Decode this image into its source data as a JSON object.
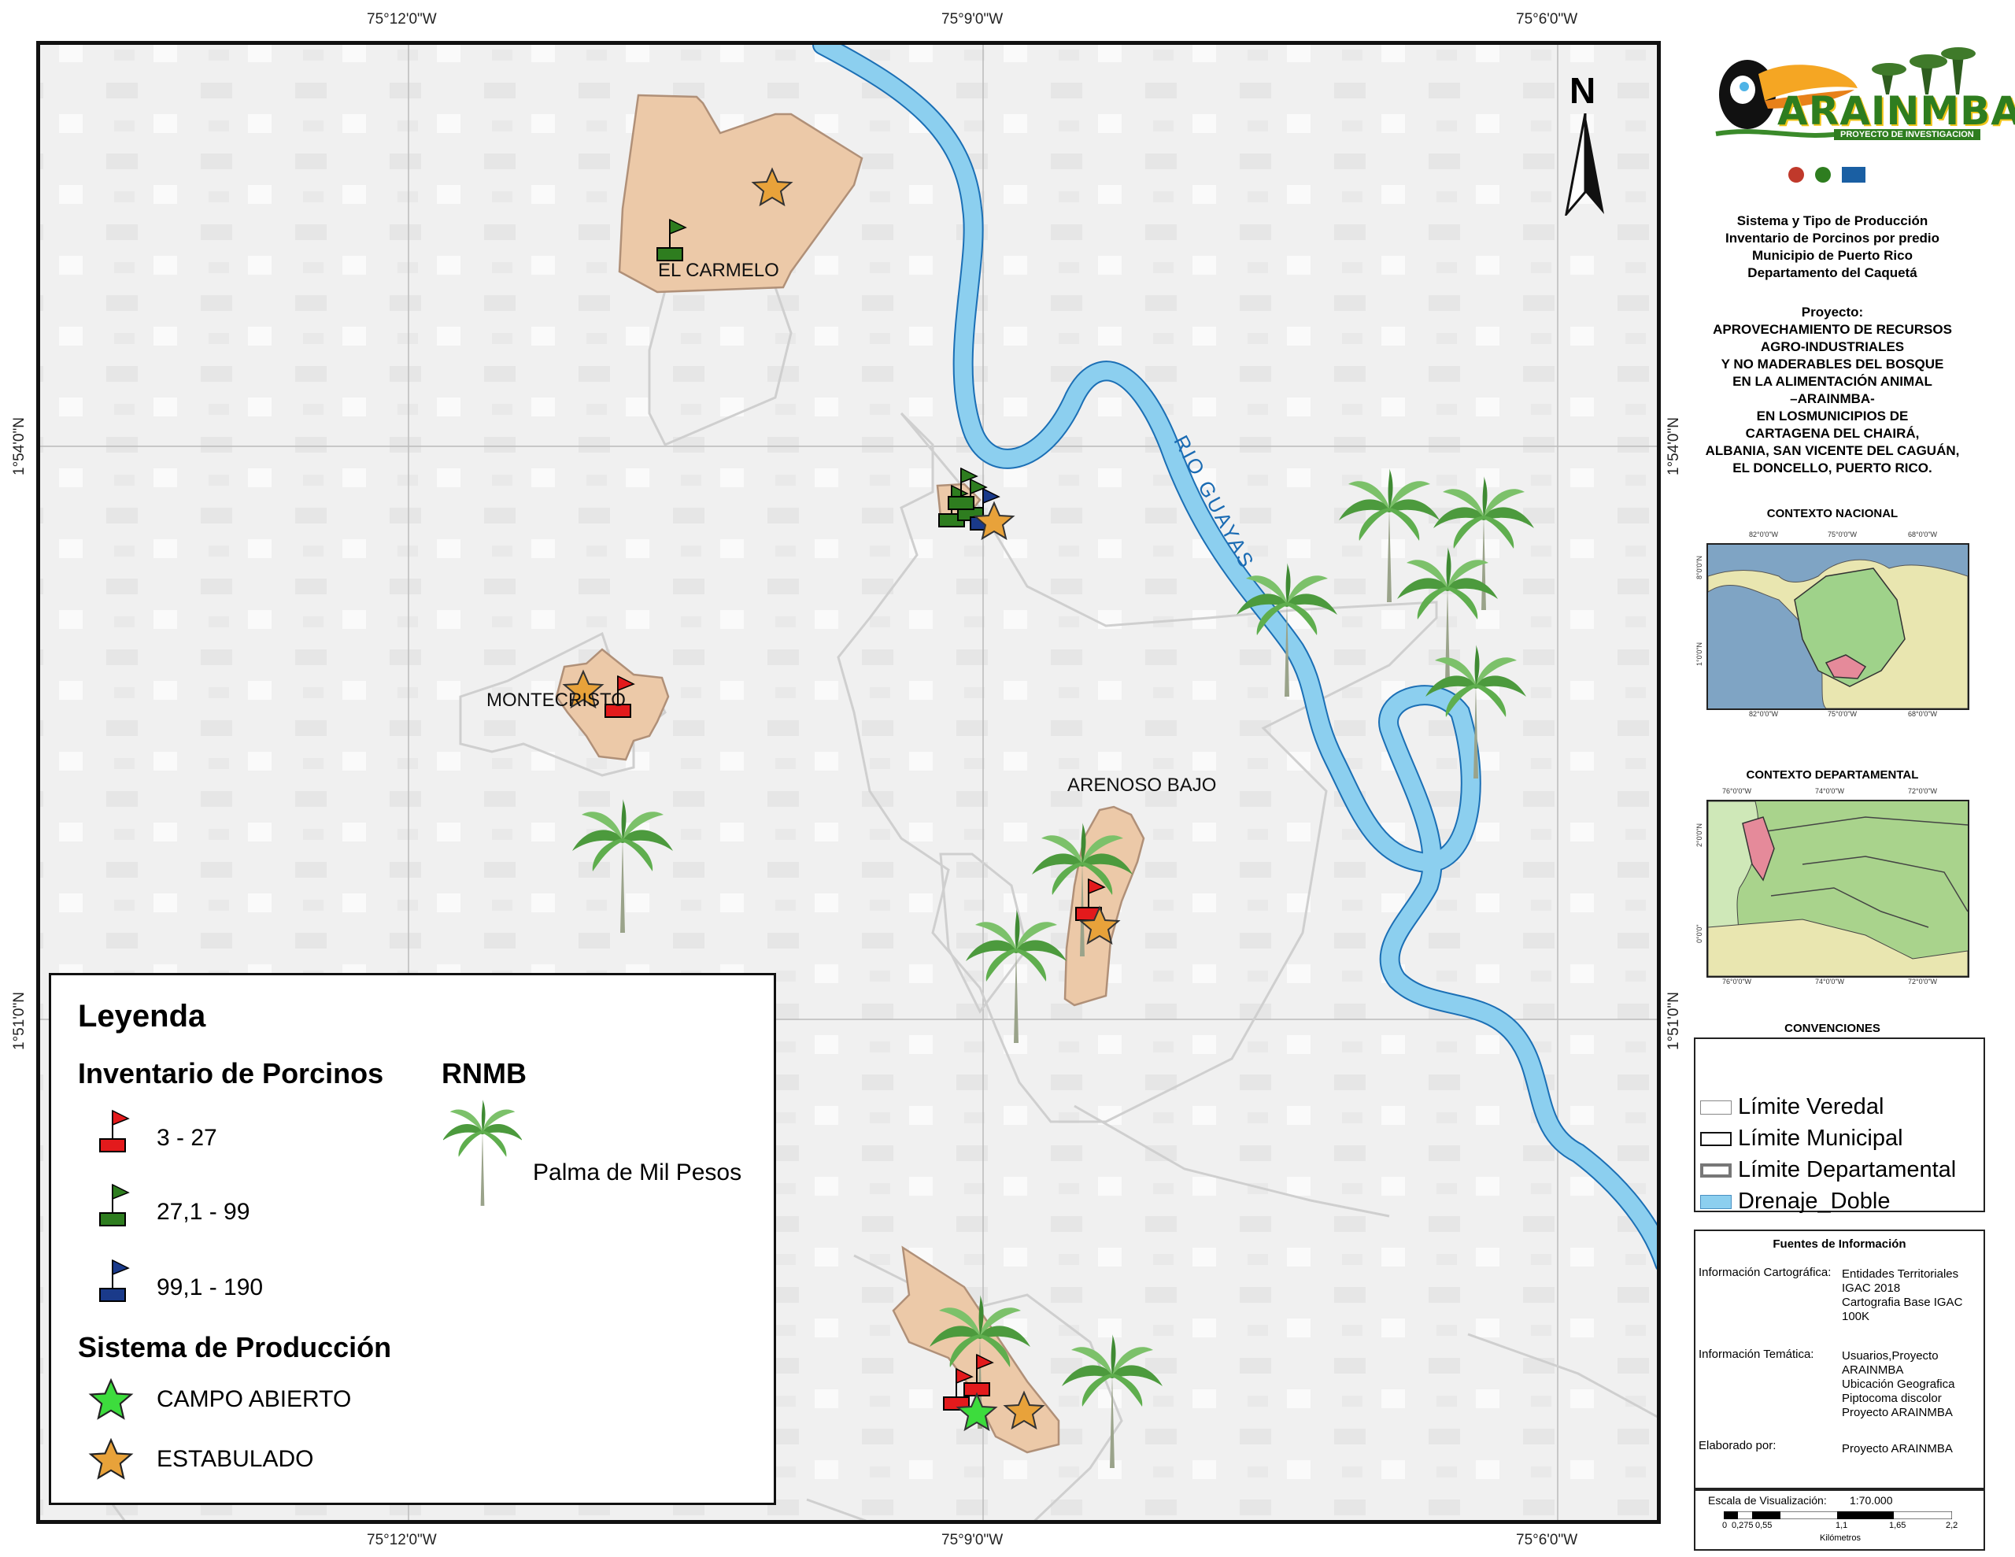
{
  "coords": {
    "top": [
      "75°12'0\"W",
      "75°9'0\"W",
      "75°6'0\"W"
    ],
    "bottom": [
      "75°12'0\"W",
      "75°9'0\"W",
      "75°6'0\"W"
    ],
    "left": [
      "1°54'0\"N",
      "1°51'0\"N"
    ],
    "right": [
      "1°54'0\"N",
      "1°51'0\"N"
    ]
  },
  "map": {
    "veredas": [
      "EL CARMELO",
      "MONTECRISTO",
      "ARENOSO BAJO"
    ],
    "river": "RIO GUAYAS",
    "north": "N"
  },
  "legend": {
    "title": "Leyenda",
    "inventory_title": "Inventario de Porcinos",
    "inventory_items": [
      {
        "label": "3 - 27",
        "color": "#e31a1c"
      },
      {
        "label": "27,1 - 99",
        "color": "#2e7d1f"
      },
      {
        "label": "99,1 - 190",
        "color": "#1a3a8a"
      }
    ],
    "rnmb_title": "RNMB",
    "rnmb_item": "Palma de Mil Pesos",
    "system_title": "Sistema de Producción",
    "system_items": [
      {
        "label": "CAMPO ABIERTO",
        "color": "#3ddc3d"
      },
      {
        "label": "ESTABULADO",
        "color": "#e8a23a"
      }
    ]
  },
  "panel": {
    "logo_word": "ARAINMBA",
    "logo_sub": "PROYECTO DE INVESTIGACION",
    "map_title": [
      "Sistema y Tipo de Producción",
      "Inventario de Porcinos por predio",
      "Municipio de Puerto Rico",
      "Departamento del Caquetá"
    ],
    "project": [
      "Proyecto:",
      "APROVECHAMIENTO DE RECURSOS",
      "AGRO-INDUSTRIALES",
      "Y NO MADERABLES DEL BOSQUE",
      "EN LA ALIMENTACIÓN ANIMAL",
      "–ARAINMBA-",
      "EN LOSMUNICIPIOS DE",
      "CARTAGENA DEL CHAIRÁ,",
      "ALBANIA, SAN VICENTE DEL CAGUÁN,",
      "EL DONCELLO, PUERTO RICO."
    ],
    "contexto_nacional": "CONTEXTO NACIONAL",
    "nacional_ticks": [
      "82°0'0\"W",
      "75°0'0\"W",
      "68°0'0\"W"
    ],
    "nacional_lat": [
      "8°0'0\"N",
      "1°0'0\"N"
    ],
    "contexto_departamental": "CONTEXTO DEPARTAMENTAL",
    "dep_ticks": [
      "76°0'0\"W",
      "74°0'0\"W",
      "72°0'0\"W"
    ],
    "dep_lat": [
      "2°0'0\"N",
      "0°0'0\""
    ],
    "convenciones": "CONVENCIONES",
    "conv_items": [
      "Límite Veredal",
      "Límite Municipal",
      "Límite Departamental",
      "Drenaje_Doble"
    ],
    "fuentes_title": "Fuentes de Información",
    "fuentes": [
      {
        "label": "Información Cartográfica:",
        "value": [
          "Entidades Territoriales",
          "IGAC 2018",
          "Cartografia Base IGAC",
          "100K"
        ]
      },
      {
        "label": "Información Temática:",
        "value": [
          "Usuarios,Proyecto",
          "ARAINMBA",
          "Ubicación Geografica",
          "Piptocoma discolor",
          "Proyecto ARAINMBA"
        ]
      },
      {
        "label": "Elaborado por:",
        "value": [
          "Proyecto ARAINMBA"
        ]
      }
    ],
    "scale_label": "Escala de Visualización:",
    "scale_value": "1:70.000",
    "scale_ticks": [
      "0",
      "0,275",
      "0,55",
      "1,1",
      "1,65",
      "2,2"
    ],
    "scale_unit": "Kilómetros"
  },
  "colors": {
    "river": "#8ccfef",
    "vereda": "#ecc9a8",
    "red": "#e31a1c",
    "green": "#2e7d1f",
    "blue": "#1a3a8a"
  }
}
